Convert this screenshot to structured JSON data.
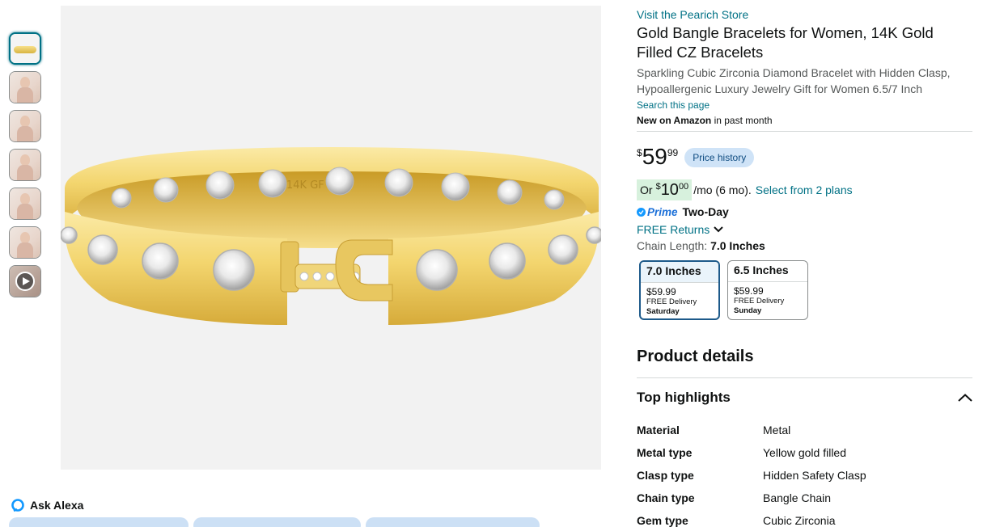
{
  "thumbnails": [
    {
      "kind": "bracelet",
      "selected": true
    },
    {
      "kind": "model"
    },
    {
      "kind": "model"
    },
    {
      "kind": "model"
    },
    {
      "kind": "model"
    },
    {
      "kind": "model"
    },
    {
      "kind": "video"
    }
  ],
  "main_image": {
    "engraving": "14K GF"
  },
  "ask_alexa": {
    "label": "Ask Alexa"
  },
  "store_link": "Visit the Pearich Store",
  "title": "Gold Bangle Bracelets for Women, 14K Gold Filled CZ Bracelets",
  "subtitle": "Sparkling Cubic Zirconia Diamond Bracelet with Hidden Clasp, Hypoallergenic Luxury Jewelry Gift for Women 6.5/7 Inch",
  "search_page": "Search this page",
  "new_on": {
    "bold": "New on Amazon",
    "rest": " in past month"
  },
  "price": {
    "symbol": "$",
    "whole": "59",
    "fraction": "99",
    "history_label": "Price history"
  },
  "plan": {
    "or": "Or",
    "symbol": "$",
    "whole": "10",
    "fraction": "00",
    "per": "/mo (6 mo).",
    "link": "Select from 2 plans"
  },
  "prime": {
    "label": "Prime",
    "delivery": "Two-Day"
  },
  "returns": "FREE Returns",
  "chain_length": {
    "label": "Chain Length:",
    "value": "7.0 Inches"
  },
  "options": [
    {
      "label": "7.0 Inches",
      "price": "$59.99",
      "delivery": "FREE Delivery",
      "day": "Saturday",
      "selected": true
    },
    {
      "label": "6.5 Inches",
      "price": "$59.99",
      "delivery": "FREE Delivery",
      "day": "Sunday",
      "selected": false
    }
  ],
  "product_details": "Product details",
  "top_highlights": "Top highlights",
  "specs": [
    {
      "key": "Material",
      "value": "Metal"
    },
    {
      "key": "Metal type",
      "value": "Yellow gold filled"
    },
    {
      "key": "Clasp type",
      "value": "Hidden Safety Clasp"
    },
    {
      "key": "Chain type",
      "value": "Bangle Chain"
    },
    {
      "key": "Gem type",
      "value": "Cubic Zirconia"
    }
  ],
  "colors": {
    "link": "#007185",
    "gold_light": "#f8e59a",
    "gold_dark": "#c99b26",
    "green_highlight": "#d7f1dd",
    "price_history_bg": "#cfe3f7"
  }
}
